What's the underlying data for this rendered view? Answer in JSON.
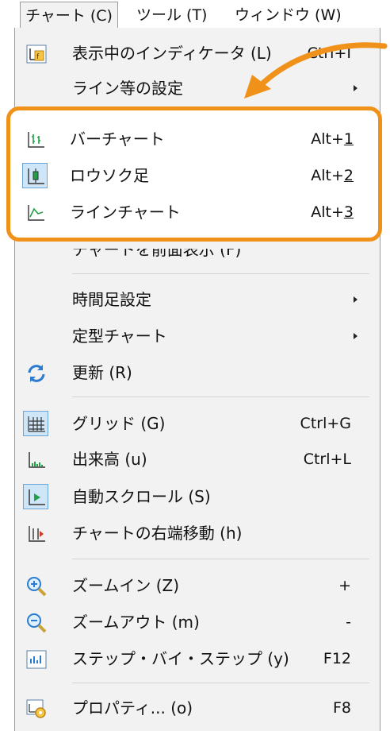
{
  "menubar": {
    "active": "チャート (C)",
    "tools": "ツール (T)",
    "window": "ウィンドウ (W)"
  },
  "menu": {
    "indicators": {
      "label": "表示中のインディケータ (L)",
      "shortcut": "Ctrl+I"
    },
    "line_settings": {
      "label": "ライン等の設定"
    },
    "chart_types": [
      {
        "label": "バーチャート",
        "shortcut_prefix": "Alt+",
        "shortcut_key": "1"
      },
      {
        "label": "ロウソク足",
        "shortcut_prefix": "Alt+",
        "shortcut_key": "2"
      },
      {
        "label": "ラインチャート",
        "shortcut_prefix": "Alt+",
        "shortcut_key": "3"
      }
    ],
    "foreground_partial": "チャートを前面表示 (F)",
    "timeframe": {
      "label": "時間足設定"
    },
    "templates": {
      "label": "定型チャート"
    },
    "refresh": {
      "label": "更新 (R)"
    },
    "grid": {
      "label": "グリッド (G)",
      "shortcut": "Ctrl+G"
    },
    "volume": {
      "label": "出来高 (u)",
      "shortcut": "Ctrl+L"
    },
    "autoscroll": {
      "label": "自動スクロール (S)"
    },
    "chart_shift": {
      "label": "チャートの右端移動 (h)"
    },
    "zoom_in": {
      "label": "ズームイン (Z)",
      "shortcut": "+"
    },
    "zoom_out": {
      "label": "ズームアウト (m)",
      "shortcut": "-"
    },
    "step": {
      "label": "ステップ・バイ・ステップ (y)",
      "shortcut": "F12"
    },
    "properties": {
      "label": "プロパティ... (o)",
      "shortcut": "F8"
    }
  },
  "colors": {
    "highlight": "#f0921a",
    "menu_bg": "#f2f2f2",
    "icon_selected_bg": "#cfe6f8"
  }
}
